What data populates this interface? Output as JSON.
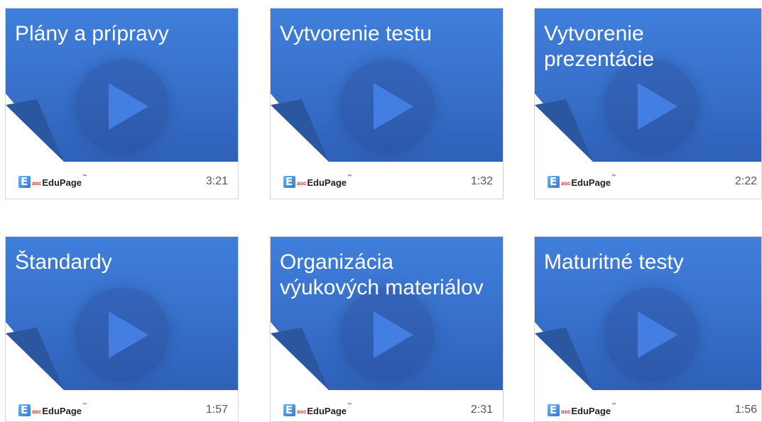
{
  "brand": {
    "asc": "asc",
    "name": "EduPage",
    "tm": "™"
  },
  "videos": [
    {
      "title": "Plány a prípravy",
      "duration": "3:21"
    },
    {
      "title": "Vytvorenie testu",
      "duration": "1:32"
    },
    {
      "title": "Vytvorenie prezentácie",
      "duration": "2:22"
    },
    {
      "title": "Štandardy",
      "duration": "1:57"
    },
    {
      "title": "Organizácia výukových materiálov",
      "duration": "2:31"
    },
    {
      "title": "Maturitné testy",
      "duration": "1:56"
    }
  ],
  "colors": {
    "thumb_top": "#3f7fdb",
    "thumb_bottom": "#2f61b8",
    "curl": "#2a579f"
  }
}
